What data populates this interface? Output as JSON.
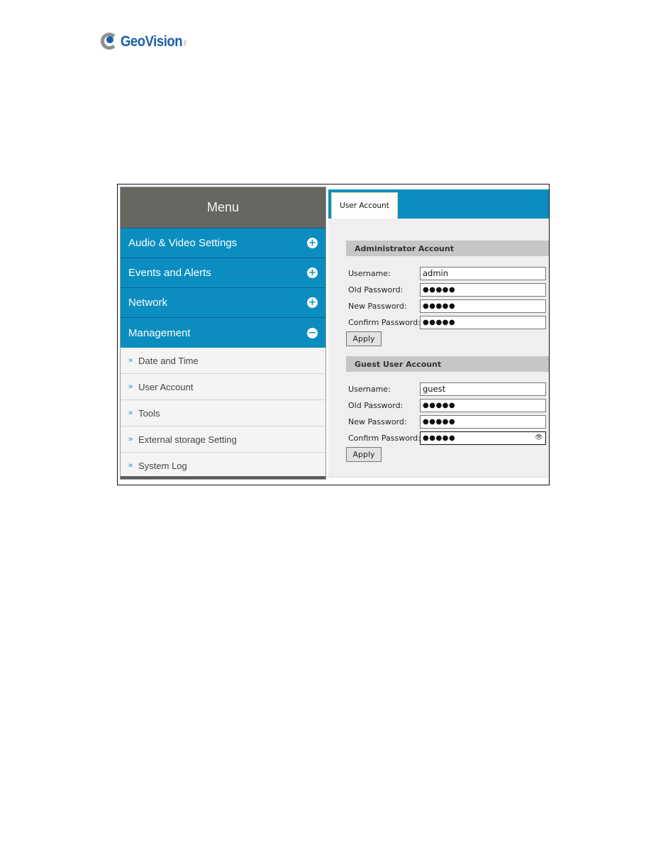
{
  "brand": {
    "name": "GeoVision",
    "suffix": "Inc."
  },
  "sidebar": {
    "title": "Menu",
    "categories": [
      {
        "label": "Audio & Video Settings",
        "icon": "plus-circle-icon",
        "expanded": false
      },
      {
        "label": "Events and Alerts",
        "icon": "plus-circle-icon",
        "expanded": false
      },
      {
        "label": "Network",
        "icon": "plus-circle-icon",
        "expanded": false
      },
      {
        "label": "Management",
        "icon": "minus-circle-icon",
        "expanded": true
      }
    ],
    "expand_glyph": "+",
    "collapse_glyph": "−",
    "sub_arrow": "»",
    "management_items": [
      "Date and Time",
      "User Account",
      "Tools",
      "External storage Setting",
      "System Log"
    ]
  },
  "main": {
    "tab": "User Account",
    "admin": {
      "title": "Administrator Account",
      "fields": [
        {
          "label": "Username:",
          "value": "admin"
        },
        {
          "label": "Old Password:",
          "value": "●●●●●"
        },
        {
          "label": "New Password:",
          "value": "●●●●●"
        },
        {
          "label": "Confirm Password:",
          "value": "●●●●●"
        }
      ],
      "apply": "Apply"
    },
    "guest": {
      "title": "Guest User Account",
      "fields": [
        {
          "label": "Username:",
          "value": "guest"
        },
        {
          "label": "Old Password:",
          "value": "●●●●●"
        },
        {
          "label": "New Password:",
          "value": "●●●●●"
        },
        {
          "label": "Confirm Password:",
          "value": "●●●●●"
        }
      ],
      "apply": "Apply",
      "reveal_icon": "👁"
    }
  },
  "colors": {
    "accent": "#0b8ebf",
    "menu_header": "#686661",
    "section_header": "#c6c6c6",
    "brand_blue": "#1b5fa8"
  }
}
